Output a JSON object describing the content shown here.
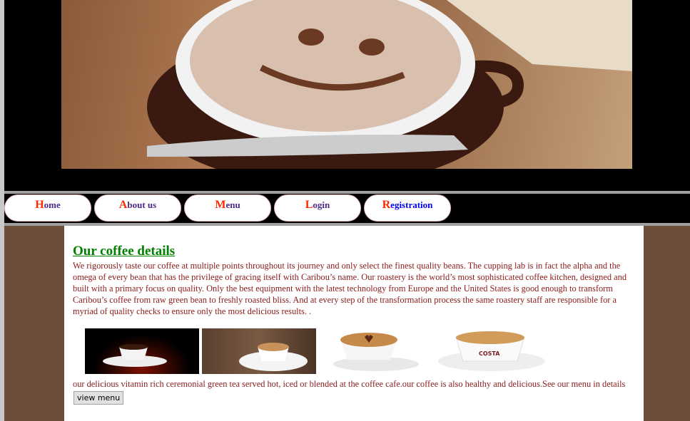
{
  "nav": [
    {
      "initial": "H",
      "rest": "ome"
    },
    {
      "initial": "A",
      "rest": "bout us"
    },
    {
      "initial": "M",
      "rest": "enu"
    },
    {
      "initial": "L",
      "rest": "ogin"
    },
    {
      "initial": "R",
      "rest": "egistration"
    }
  ],
  "main": {
    "heading": "Our coffee details",
    "paragraph": "We rigorously taste our coffee at multiple points throughout its journey and only select the finest quality beans. The cupping lab is in fact the alpha and the omega of every bean that has the privilege of gracing itself with Caribou’s name. Our roastery is the world’s most sophisticated coffee kitchen, designed and built with a primary focus on quality. Only the best equipment with the latest technology from Europe and the United States is good enough to transform Caribou’s coffee from raw green bean to freshly roasted bliss. And at every step of the transformation process the same roastery staff are responsible for a myriad of quality checks to ensure only the most delicious results. .",
    "caption": "our delicious vitamin rich ceremonial green tea served hot, iced or blended at the coffee cafe.our coffee is also healthy and delicious.See our menu in details",
    "button": "view menu",
    "cup_brand": "COSTA"
  }
}
